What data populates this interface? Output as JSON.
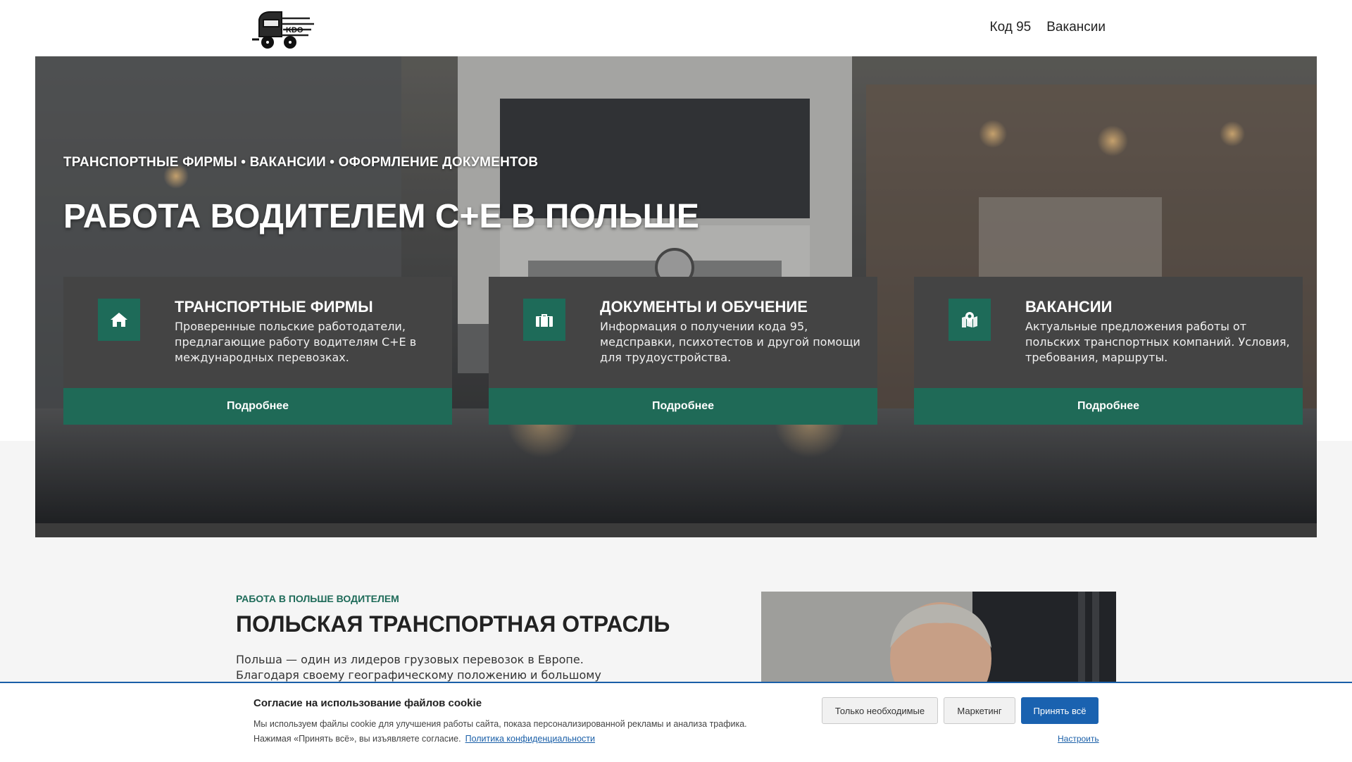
{
  "header": {
    "logo_label": "KDO",
    "nav": [
      {
        "label": "Код 95"
      },
      {
        "label": "Вакансии"
      }
    ]
  },
  "hero": {
    "subtitle": "ТРАНСПОРТНЫЕ ФИРМЫ • ВАКАНСИИ • ОФОРМЛЕНИЕ ДОКУМЕНТОВ",
    "title": "РАБОТА ВОДИТЕЛЕМ С+Е В ПОЛЬШЕ",
    "cards": [
      {
        "icon": "home-icon",
        "title": "ТРАНСПОРТНЫЕ ФИРМЫ",
        "text": "Проверенные польские работодатели, предлагающие работу водителям С+Е в международных перевозках.",
        "button": "Подробнее"
      },
      {
        "icon": "briefcase-icon",
        "title": "ДОКУМЕНТЫ И ОБУЧЕНИЕ",
        "text": "Информация о получении кода 95, медсправки, психотестов и другой помощи для трудоустройства.",
        "button": "Подробнее"
      },
      {
        "icon": "map-pin-icon",
        "title": "ВАКАНСИИ",
        "text": "Актуальные предложения работы от польских транспортных компаний. Условия, требования, маршруты.",
        "button": "Подробнее"
      }
    ]
  },
  "section": {
    "kicker": "РАБОТА В ПОЛЬШЕ ВОДИТЕЛЕМ",
    "title": "ПОЛЬСКАЯ ТРАНСПОРТНАЯ ОТРАСЛЬ",
    "text": "Польша — один из лидеров грузовых перевозок в Европе. Благодаря своему географическому положению и большому количеству"
  },
  "cookie": {
    "title": "Согласие на использование файлов cookie",
    "text_line1": "Мы используем файлы cookie для улучшения работы сайта, показа персонализированной рекламы и анализа трафика.",
    "text_line2": "Нажимая «Принять всё», вы изъявляете согласие.",
    "policy_link": "Политика конфиденциальности",
    "btn_necessary": "Только необходимые",
    "btn_marketing": "Маркетинг",
    "btn_accept": "Принять всё",
    "configure": "Настроить"
  },
  "colors": {
    "accent_green": "#1f6a57",
    "card_bg": "#444444",
    "link_blue": "#1a62b0"
  }
}
